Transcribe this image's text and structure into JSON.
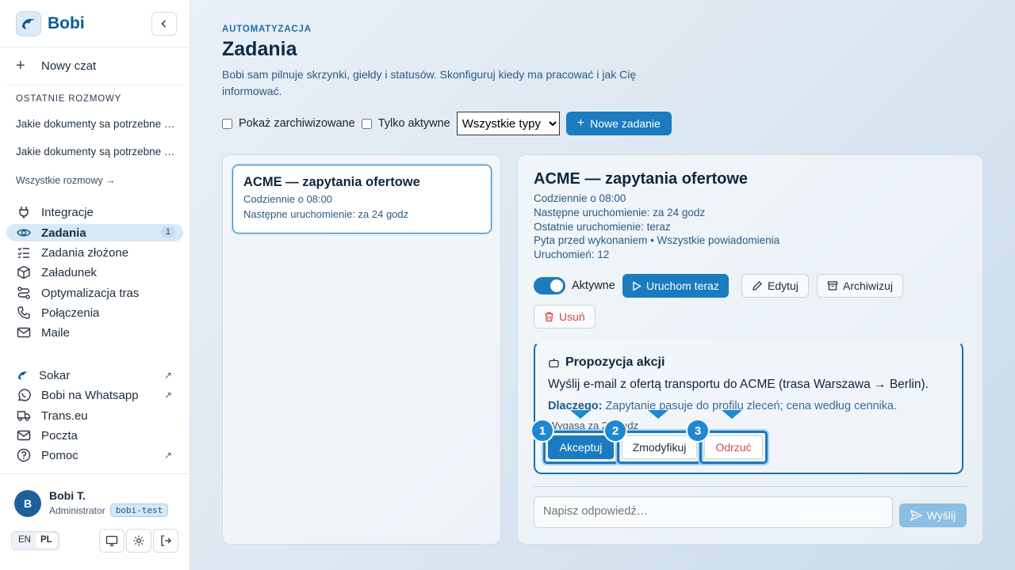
{
  "brand": {
    "name": "Bobi"
  },
  "sidebar": {
    "new_chat": "Nowy czat",
    "recent_label": "OSTATNIE ROZMOWY",
    "recent": [
      "Jakie dokumenty sa potrzebne …",
      "Jakie dokumenty są potrzebne …"
    ],
    "all_chats": "Wszystkie rozmowy →",
    "nav": [
      {
        "label": "Integracje",
        "icon": "plug-icon"
      },
      {
        "label": "Zadania",
        "icon": "eye-icon",
        "badge": "1",
        "active": true
      },
      {
        "label": "Zadania złożone",
        "icon": "checklist-icon"
      },
      {
        "label": "Załadunek",
        "icon": "package-icon"
      },
      {
        "label": "Optymalizacja tras",
        "icon": "route-icon"
      },
      {
        "label": "Połączenia",
        "icon": "phone-icon"
      },
      {
        "label": "Maile",
        "icon": "mail-icon"
      }
    ],
    "links": [
      {
        "label": "Sokar",
        "icon": "logo-icon",
        "external": "↗"
      },
      {
        "label": "Bobi na Whatsapp",
        "icon": "whatsapp-icon",
        "external": "↗"
      },
      {
        "label": "Trans.eu",
        "icon": "truck-icon"
      },
      {
        "label": "Poczta",
        "icon": "mail-icon"
      },
      {
        "label": "Pomoc",
        "icon": "help-icon",
        "external": "↗"
      }
    ],
    "user": {
      "initial": "B",
      "name": "Bobi T.",
      "role": "Administrator",
      "env": "bobi-test"
    },
    "lang": {
      "en": "EN",
      "pl": "PL",
      "selected": "PL"
    }
  },
  "header": {
    "eyebrow": "AUTOMATYZACJA",
    "title": "Zadania",
    "description": "Bobi sam pilnuje skrzynki, giełdy i statusów. Skonfiguruj kiedy ma pracować i jak Cię informować."
  },
  "filters": {
    "show_archived": "Pokaż zarchiwizowane",
    "only_active": "Tylko aktywne",
    "type_select": "Wszystkie typy",
    "new_task": "Nowe zadanie"
  },
  "task_list": [
    {
      "title": "ACME — zapytania ofertowe",
      "schedule": "Codziennie o 08:00",
      "next_run": "Następne uruchomienie: za 24 godz"
    }
  ],
  "detail": {
    "title": "ACME — zapytania ofertowe",
    "schedule": "Codziennie o 08:00",
    "next_run": "Następne uruchomienie: za 24 godz",
    "last_run": "Ostatnie uruchomienie: teraz",
    "mode": "Pyta przed wykonaniem  •  Wszystkie powiadomienia",
    "runs": "Uruchomień: 12",
    "active_label": "Aktywne",
    "active": true,
    "run_now": "Uruchom teraz",
    "edit": "Edytuj",
    "archive": "Archiwizuj",
    "delete": "Usuń",
    "proposal": {
      "title": "Propozycja akcji",
      "text": "Wyślij e-mail z ofertą transportu do ACME (trasa Warszawa → Berlin).",
      "why_label": "Dlaczego:",
      "why": "Zapytanie pasuje do profilu zleceń; cena według cennika.",
      "expires": "Wygasa za 24 godz",
      "accept": "Akceptuj",
      "modify": "Zmodyfikuj",
      "reject": "Odrzuć",
      "markers": [
        "1",
        "2",
        "3"
      ]
    },
    "reply_placeholder": "Napisz odpowiedź…",
    "send": "Wyślij"
  },
  "colors": {
    "accent": "#1b7bbf",
    "danger": "#d04a4a",
    "marker": "#1e88d2"
  }
}
